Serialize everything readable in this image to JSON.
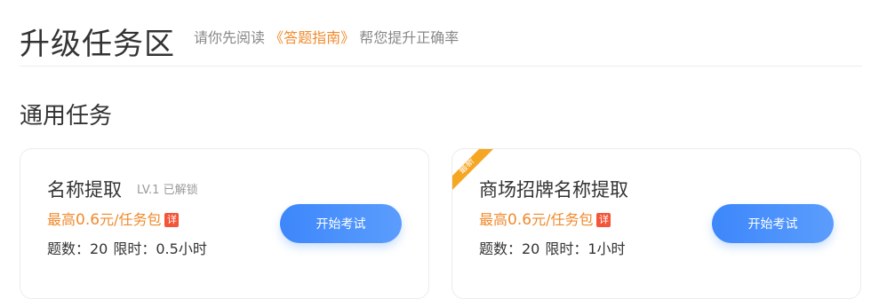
{
  "header": {
    "title": "升级任务区",
    "hint_prefix": "请你先阅读",
    "hint_link": "《答题指南》",
    "hint_suffix": "帮您提升正确率"
  },
  "section": {
    "title": "通用任务"
  },
  "tasks": [
    {
      "name": "名称提取",
      "level": "LV.1 已解锁",
      "reward_prefix": "最高",
      "reward_amount": "0.6",
      "reward_suffix": "元/任务包",
      "detail_badge": "详",
      "meta_questions": "题数：20",
      "meta_time": "限时：0.5小时",
      "button": "开始考试",
      "badge": ""
    },
    {
      "name": "商场招牌名称提取",
      "level": "",
      "reward_prefix": "最高",
      "reward_amount": "0.6",
      "reward_suffix": "元/任务包",
      "detail_badge": "详",
      "meta_questions": "题数：20",
      "meta_time": "限时：1小时",
      "button": "开始考试",
      "badge": "最新"
    }
  ],
  "colors": {
    "accent_orange": "#f08a2c",
    "button_blue": "#3d87fb",
    "badge_red": "#f4553a",
    "ribbon_orange": "#f5a623"
  }
}
